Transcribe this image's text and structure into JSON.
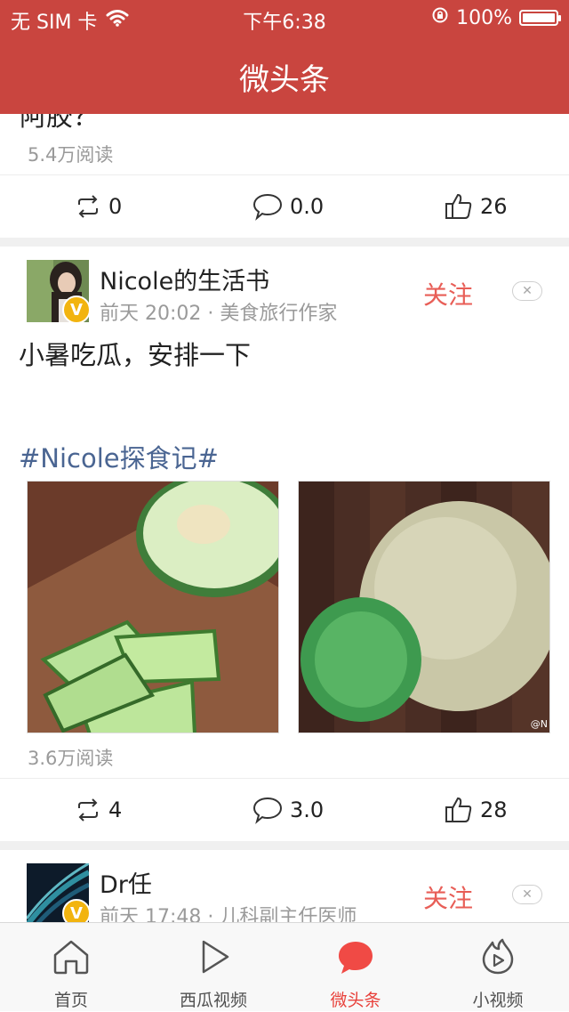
{
  "status_bar": {
    "carrier": "无 SIM 卡",
    "time": "下午6:38",
    "battery": "100%"
  },
  "nav": {
    "title": "微头条"
  },
  "posts": [
    {
      "cut_text": "阿胶？",
      "reads": "5.4万阅读",
      "repost_count": "0",
      "comment_count": "0.0",
      "like_count": "26"
    },
    {
      "author": "Nicole的生活书",
      "meta": "前天 20:02 · 美食旅行作家",
      "follow_label": "关注",
      "text": "小暑吃瓜，安排一下",
      "hashtag": "#Nicole探食记#",
      "photo_watermark": "@N",
      "reads": "3.6万阅读",
      "repost_count": "4",
      "comment_count": "3.0",
      "like_count": "28"
    },
    {
      "author": "Dr任",
      "meta": "前天 17:48 · 儿科副主任医师",
      "follow_label": "关注"
    }
  ],
  "tabbar": [
    {
      "label": "首页",
      "icon": "home-icon",
      "active": false
    },
    {
      "label": "西瓜视频",
      "icon": "play-icon",
      "active": false
    },
    {
      "label": "微头条",
      "icon": "chat-bubble-icon",
      "active": true
    },
    {
      "label": "小视频",
      "icon": "flame-play-icon",
      "active": false
    }
  ],
  "colors": {
    "brand_red": "#c9453f",
    "follow_red": "#e85e57",
    "hashtag_blue": "#4a6592",
    "active_tab": "#e8403a",
    "verified_badge": "#f2b40f"
  }
}
